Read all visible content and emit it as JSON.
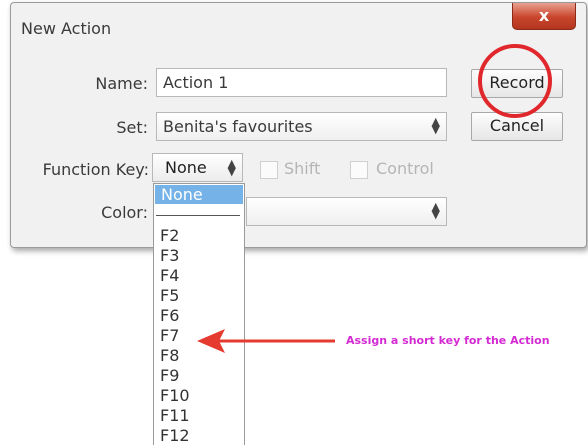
{
  "dialog": {
    "title": "New Action",
    "close_glyph": "x"
  },
  "form": {
    "name_label": "Name:",
    "name_value": "Action 1",
    "set_label": "Set:",
    "set_value": "Benita's favourites",
    "fkey_label": "Function Key:",
    "fkey_value": "None",
    "shift_label": "Shift",
    "control_label": "Control",
    "color_label": "Color:"
  },
  "buttons": {
    "record": "Record",
    "cancel": "Cancel"
  },
  "function_key_dropdown": {
    "selected": "None",
    "items": [
      "F2",
      "F3",
      "F4",
      "F5",
      "F6",
      "F7",
      "F8",
      "F9",
      "F10",
      "F11",
      "F12"
    ]
  },
  "annotation": {
    "text": "Assign a short key for the Action",
    "arrow_color": "#e43a2f",
    "text_color": "#d42ad2",
    "circle_color": "#e0282c"
  }
}
